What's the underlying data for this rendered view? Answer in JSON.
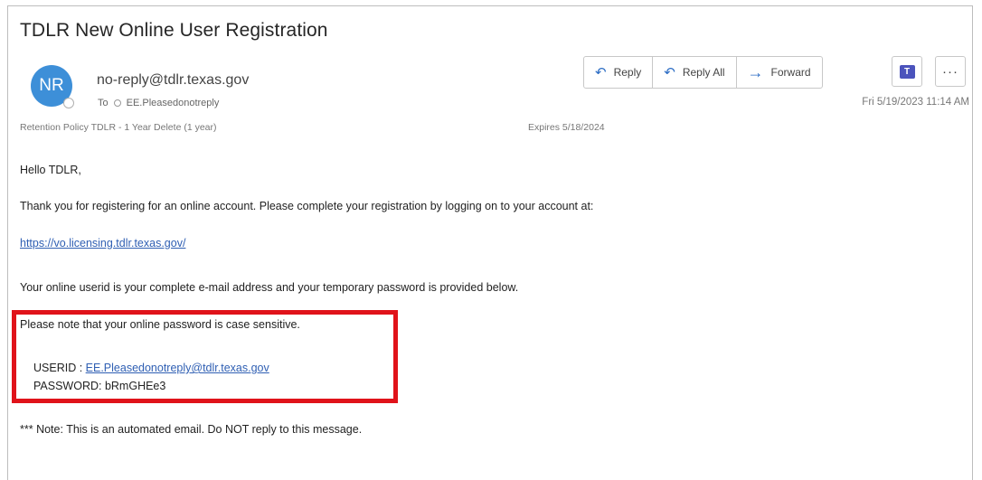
{
  "email": {
    "subject": "TDLR New Online User Registration",
    "avatar_initials": "NR",
    "sender": "no-reply@tdlr.texas.gov",
    "to_label": "To",
    "to_recipient": "EE.Pleasedonotreply",
    "retention": "Retention Policy   TDLR - 1 Year Delete (1 year)",
    "expires": "Expires   5/18/2024",
    "date": "Fri 5/19/2023 11:14 AM"
  },
  "toolbar": {
    "reply_label": "Reply",
    "reply_all_label": "Reply All",
    "forward_label": "Forward",
    "more_label": "···",
    "teams_logo": "T"
  },
  "icons": {
    "reply": "reply-icon",
    "reply_all": "reply-all-icon",
    "forward": "forward-arrow-icon",
    "teams": "teams-icon",
    "more": "more-icon"
  },
  "body": {
    "greeting": "Hello TDLR,",
    "line1": "Thank you for registering for an online account.  Please complete your registration by logging on to your account at:",
    "link": "https://vo.licensing.tdlr.texas.gov/",
    "line2": "Your online userid is your complete e-mail address and your temporary password is provided below.",
    "line3": "Please note that your online password is case sensitive.",
    "userid_label": "USERID  : ",
    "userid_value": "EE.Pleasedonotreply@tdlr.texas.gov",
    "password_label": "PASSWORD: ",
    "password_value": "bRmGHEe3",
    "note": "*** Note: This is an automated email.  Do NOT reply to this message."
  },
  "colors": {
    "accent": "#2b6cc4",
    "avatar": "#3d8fd8",
    "highlight_box": "#e0131a",
    "link": "#2f5fb3"
  }
}
